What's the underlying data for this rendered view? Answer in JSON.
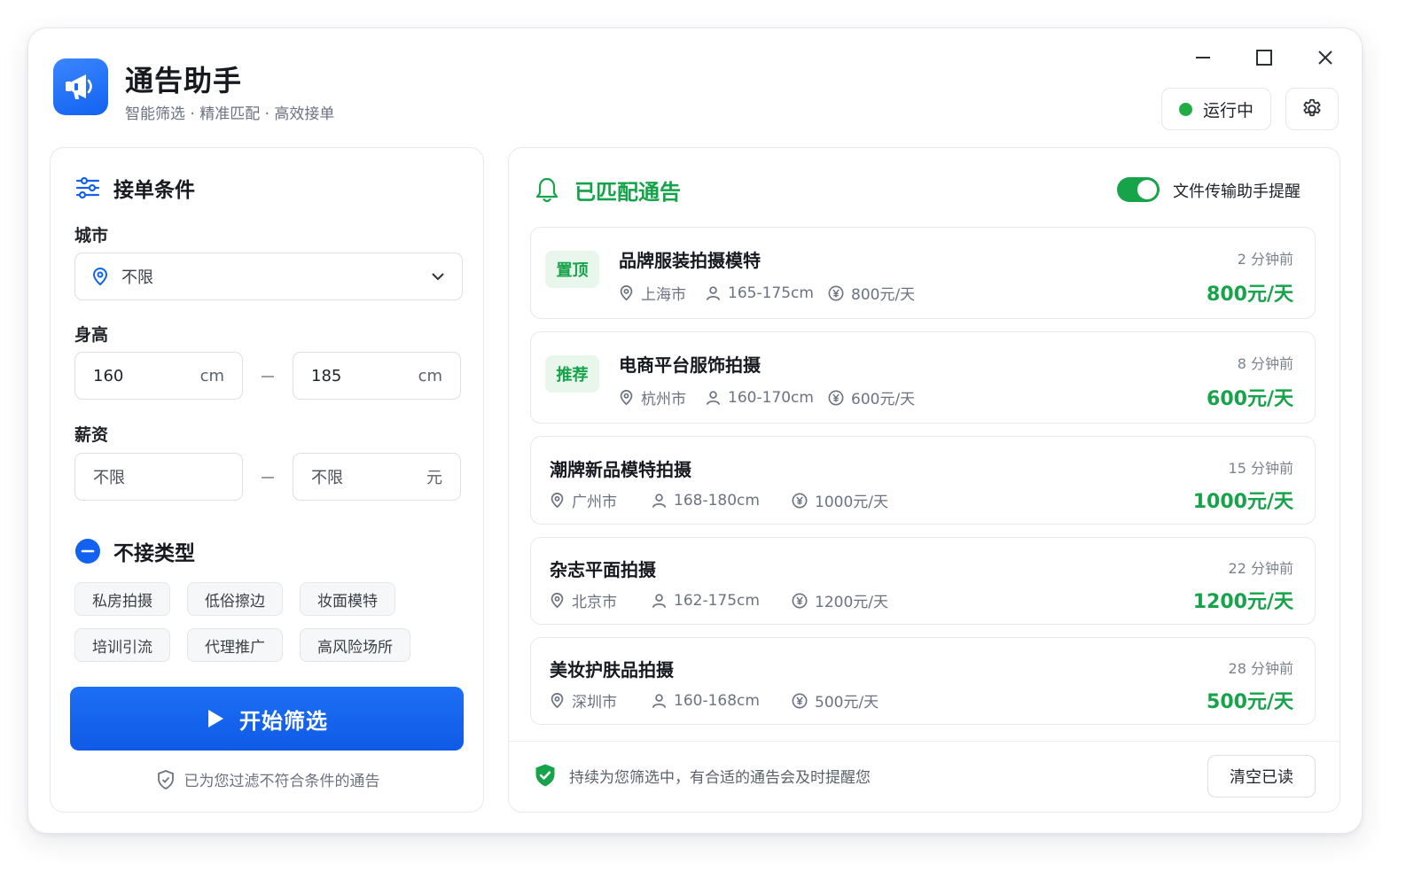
{
  "app": {
    "title": "通告助手",
    "subtitle": "智能筛选 · 精准匹配 · 高效接单",
    "status": "运行中",
    "colors": {
      "primary": "#1262f0",
      "green": "#16a34a"
    }
  },
  "filters": {
    "title": "接单条件",
    "city": {
      "label": "城市",
      "value": "不限"
    },
    "height": {
      "label": "身高",
      "min": "160",
      "max": "185",
      "unit": "cm"
    },
    "salary": {
      "label": "薪资",
      "min": "不限",
      "max": "不限",
      "unit": "元"
    },
    "exclude": {
      "title": "不接类型",
      "tags": [
        "私房拍摄",
        "低俗擦边",
        "妆面模特",
        "培训引流",
        "代理推广",
        "高风险场所"
      ]
    },
    "start_button": "开始筛选",
    "note": "已为您过滤不符合条件的通告"
  },
  "matched": {
    "title": "已匹配通告",
    "toggle_label": "文件传输助手提醒",
    "toggle_on": true,
    "cards": [
      {
        "badge": "置顶",
        "title": "品牌服装拍摄模特",
        "city": "上海市",
        "height": "165-175cm",
        "pay": "800元/天",
        "time": "2 分钟前",
        "price": "800元/天"
      },
      {
        "badge": "推荐",
        "title": "电商平台服饰拍摄",
        "city": "杭州市",
        "height": "160-170cm",
        "pay": "600元/天",
        "time": "8 分钟前",
        "price": "600元/天"
      },
      {
        "badge": "",
        "title": "潮牌新品模特拍摄",
        "city": "广州市",
        "height": "168-180cm",
        "pay": "1000元/天",
        "time": "15 分钟前",
        "price": "1000元/天"
      },
      {
        "badge": "",
        "title": "杂志平面拍摄",
        "city": "北京市",
        "height": "162-175cm",
        "pay": "1200元/天",
        "time": "22 分钟前",
        "price": "1200元/天"
      },
      {
        "badge": "",
        "title": "美妆护肤品拍摄",
        "city": "深圳市",
        "height": "160-168cm",
        "pay": "500元/天",
        "time": "28 分钟前",
        "price": "500元/天"
      }
    ],
    "footer_note": "持续为您筛选中，有合适的通告会及时提醒您",
    "clear_button": "清空已读"
  }
}
